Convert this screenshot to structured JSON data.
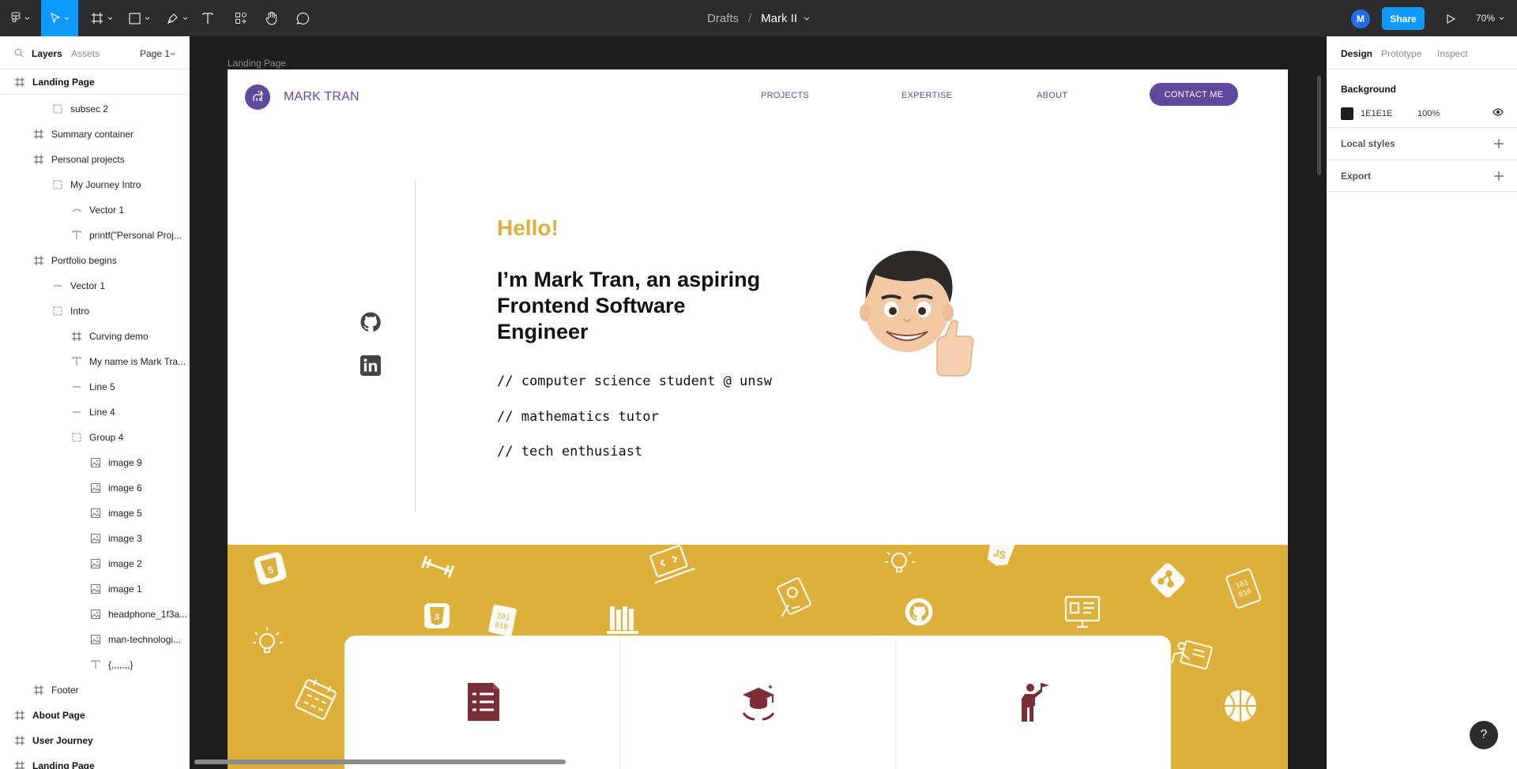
{
  "toolbar": {
    "breadcrumb_project": "Drafts",
    "breadcrumb_sep": "/",
    "file_name": "Mark II",
    "avatar_initial": "M",
    "share_label": "Share",
    "zoom_level": "70%",
    "tools": [
      "main-menu",
      "move-tool",
      "frame-tool",
      "shape-tool",
      "pen-tool",
      "text-tool",
      "resources-tool",
      "hand-tool",
      "comment-tool"
    ]
  },
  "left_panel": {
    "tab_layers": "Layers",
    "tab_assets": "Assets",
    "page_selector": "Page 1",
    "sticky_frame": "Landing Page",
    "layers": [
      {
        "label": "subsec 2",
        "icon": "group-icon"
      },
      {
        "label": "Summary container",
        "icon": "frame-icon"
      },
      {
        "label": "Personal projects",
        "icon": "frame-icon"
      },
      {
        "label": "My Journey Intro",
        "icon": "group-icon"
      },
      {
        "label": "Vector 1",
        "icon": "vector-icon"
      },
      {
        "label": "printf(\"Personal Proj...",
        "icon": "text-icon"
      },
      {
        "label": "Portfolio begins",
        "icon": "frame-icon"
      },
      {
        "label": "Vector 1",
        "icon": "line-icon"
      },
      {
        "label": "Intro",
        "icon": "group-icon"
      },
      {
        "label": "Curving demo",
        "icon": "frame-icon"
      },
      {
        "label": "My name is Mark Tra...",
        "icon": "text-icon"
      },
      {
        "label": "Line 5",
        "icon": "line-icon"
      },
      {
        "label": "Line 4",
        "icon": "line-icon"
      },
      {
        "label": "Group 4",
        "icon": "group-icon"
      },
      {
        "label": "image 9",
        "icon": "image-icon"
      },
      {
        "label": "image 6",
        "icon": "image-icon"
      },
      {
        "label": "image 5",
        "icon": "image-icon"
      },
      {
        "label": "image 3",
        "icon": "image-icon"
      },
      {
        "label": "image 2",
        "icon": "image-icon"
      },
      {
        "label": "image 1",
        "icon": "image-icon"
      },
      {
        "label": "headphone_1f3a...",
        "icon": "image-icon"
      },
      {
        "label": "man-technologi...",
        "icon": "image-icon"
      },
      {
        "label": "{,,,,,,,}",
        "icon": "text-icon"
      },
      {
        "label": "Footer",
        "icon": "frame-icon"
      },
      {
        "label": "About Page",
        "icon": "frame-icon"
      },
      {
        "label": "User Journey",
        "icon": "frame-icon"
      },
      {
        "label": "Landing Page",
        "icon": "frame-icon"
      }
    ]
  },
  "canvas": {
    "frame_label": "Landing Page",
    "site": {
      "name": "MARK TRAN",
      "nav": [
        "PROJECTS",
        "EXPERTISE",
        "ABOUT"
      ],
      "contact": "CONTACT ME",
      "hello": "Hello!",
      "headline": "I’m Mark Tran, an aspiring Frontend Software Engineer",
      "code_lines": [
        "// computer science student @ unsw",
        "// mathematics tutor",
        "// tech enthusiast"
      ],
      "accent_color": "#5D4A9C",
      "highlight_color": "#DCB03A",
      "card_icon_color": "#7A2E3A"
    }
  },
  "right_panel": {
    "tab_design": "Design",
    "tab_prototype": "Prototype",
    "tab_inspect": "Inspect",
    "background_title": "Background",
    "background_hex": "1E1E1E",
    "background_opacity": "100%",
    "local_styles": "Local styles",
    "export": "Export"
  },
  "help_label": "?"
}
